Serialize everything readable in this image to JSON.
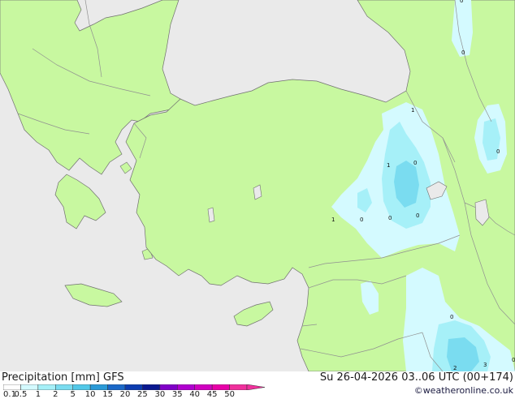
{
  "title": "Precipitation [mm] GFS",
  "run_info": "Su 26-04-2026 03..06 UTC (00+174)",
  "credit": "©weatheronline.co.uk",
  "legend": {
    "ticks": [
      "0.1",
      "0.5",
      "1",
      "2",
      "5",
      "10",
      "15",
      "20",
      "25",
      "30",
      "35",
      "40",
      "45",
      "50"
    ],
    "colors": [
      "#ffffff",
      "#d4faff",
      "#a6f0f8",
      "#7adcf0",
      "#52c8e8",
      "#2a9ad8",
      "#1a68c8",
      "#0c3cb0",
      "#0a1890",
      "#8000c8",
      "#b000d0",
      "#d000c0",
      "#e800a8",
      "#f0309c"
    ]
  },
  "map_labels": [
    "0",
    "0",
    "1",
    "0",
    "1",
    "0",
    "1",
    "0",
    "0",
    "0",
    "0",
    "2",
    "3",
    "0"
  ],
  "colors": {
    "land": "#c8f8a0",
    "sea": "#eaeaea",
    "border": "#909090",
    "coast": "#707070"
  }
}
